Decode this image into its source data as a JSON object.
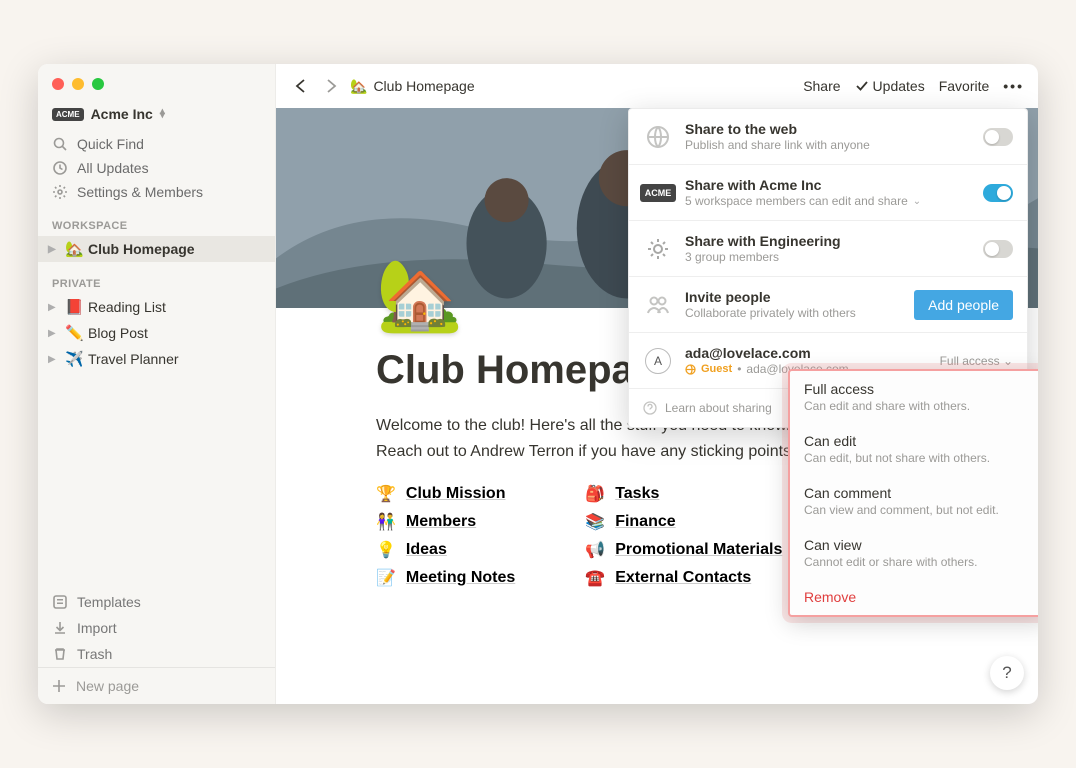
{
  "workspace": {
    "name": "Acme Inc"
  },
  "sidebar": {
    "quick_find": "Quick Find",
    "all_updates": "All Updates",
    "settings": "Settings & Members",
    "workspace_label": "WORKSPACE",
    "private_label": "PRIVATE",
    "workspace_pages": [
      {
        "emoji": "🏡",
        "label": "Club Homepage"
      }
    ],
    "private_pages": [
      {
        "emoji": "📕",
        "label": "Reading List"
      },
      {
        "emoji": "✏️",
        "label": "Blog Post"
      },
      {
        "emoji": "✈️",
        "label": "Travel Planner"
      }
    ],
    "templates": "Templates",
    "import": "Import",
    "trash": "Trash",
    "new_page": "New page"
  },
  "topbar": {
    "breadcrumb_emoji": "🏡",
    "breadcrumb_label": "Club Homepage",
    "share": "Share",
    "updates": "Updates",
    "favorite": "Favorite"
  },
  "page": {
    "emoji": "🏡",
    "title": "Club Homepage",
    "body_line1": "Welcome to the club! Here's all the stuff you need to know.",
    "body_line2": "Reach out to Andrew Terron if you have any sticking points.",
    "links_col1": [
      {
        "emoji": "🏆",
        "label": "Club Mission"
      },
      {
        "emoji": "👫",
        "label": "Members"
      },
      {
        "emoji": "💡",
        "label": "Ideas"
      },
      {
        "emoji": "📝",
        "label": "Meeting Notes"
      }
    ],
    "links_col2": [
      {
        "emoji": "🎒",
        "label": "Tasks"
      },
      {
        "emoji": "📚",
        "label": "Finance"
      },
      {
        "emoji": "📢",
        "label": "Promotional Materials"
      },
      {
        "emoji": "☎️",
        "label": "External Contacts"
      }
    ]
  },
  "share_panel": {
    "web": {
      "title": "Share to the web",
      "sub": "Publish and share link with anyone",
      "on": false
    },
    "workspace": {
      "title": "Share with Acme Inc",
      "sub": "5 workspace members can edit and share",
      "on": true
    },
    "group": {
      "title": "Share with Engineering",
      "sub": "3 group members",
      "on": false
    },
    "invite": {
      "title": "Invite people",
      "sub": "Collaborate privately with others",
      "button": "Add people"
    },
    "guest": {
      "avatar_letter": "A",
      "email": "ada@lovelace.com",
      "badge": "Guest",
      "sub_email": "ada@lovelace.com",
      "access_label": "Full access"
    },
    "learn": "Learn about sharing"
  },
  "access_menu": {
    "items": [
      {
        "title": "Full access",
        "sub": "Can edit and share with others."
      },
      {
        "title": "Can edit",
        "sub": "Can edit, but not share with others."
      },
      {
        "title": "Can comment",
        "sub": "Can view and comment, but not edit."
      },
      {
        "title": "Can view",
        "sub": "Cannot edit or share with others."
      }
    ],
    "remove": "Remove"
  }
}
